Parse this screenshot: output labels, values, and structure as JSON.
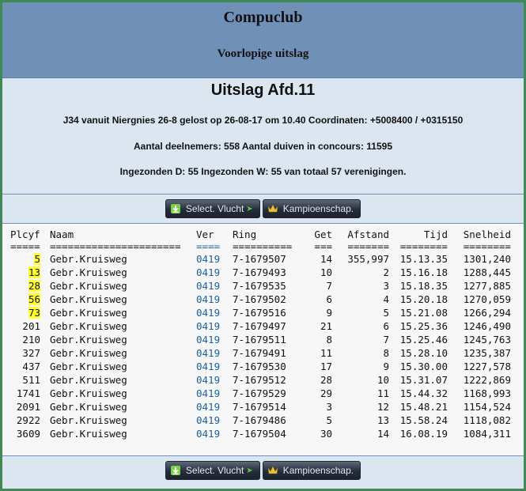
{
  "header": {
    "club": "Compuclub",
    "subtitle": "Voorlopige uitslag"
  },
  "info": {
    "title": "Uitslag Afd.11",
    "line1": "J34 vanuit Niergnies 26-8 gelost op 26-08-17 om 10.40 Coordinaten: +5008400 / +0315150",
    "line2": "Aantal deelnemers: 558 Aantal duiven in concours: 11595",
    "line3": "Ingezonden D: 55 Ingezonden W: 55 van totaal 57 verenigingen."
  },
  "buttons": {
    "select_flight": "Select. Vlucht",
    "championship": "Kampioenschap."
  },
  "colors": {
    "header_bg": "#7090b8",
    "page_bg": "#dce6f0",
    "border": "#3f8a56",
    "highlight": "#ffff33",
    "link": "#1a5fa0"
  },
  "table": {
    "headers": [
      "Plcyf",
      "Naam",
      "Ver",
      "Ring",
      "Get",
      "Afstand",
      "Tijd",
      "Snelheid"
    ],
    "separators": [
      "=====",
      "======================",
      "====",
      "==========",
      "===",
      "=======",
      "========",
      "========"
    ],
    "rows": [
      {
        "plcyf": "5",
        "naam": "Gebr.Kruisweg",
        "ver": "0419",
        "ring": "7-1679507",
        "get": "14",
        "afstand": "355,997",
        "tijd": "15.13.35",
        "snelheid": "1301,240",
        "hl": true
      },
      {
        "plcyf": "13",
        "naam": "Gebr.Kruisweg",
        "ver": "0419",
        "ring": "7-1679493",
        "get": "10",
        "afstand": "2",
        "tijd": "15.16.18",
        "snelheid": "1288,445",
        "hl": true
      },
      {
        "plcyf": "28",
        "naam": "Gebr.Kruisweg",
        "ver": "0419",
        "ring": "7-1679535",
        "get": "7",
        "afstand": "3",
        "tijd": "15.18.35",
        "snelheid": "1277,885",
        "hl": true
      },
      {
        "plcyf": "56",
        "naam": "Gebr.Kruisweg",
        "ver": "0419",
        "ring": "7-1679502",
        "get": "6",
        "afstand": "4",
        "tijd": "15.20.18",
        "snelheid": "1270,059",
        "hl": true
      },
      {
        "plcyf": "73",
        "naam": "Gebr.Kruisweg",
        "ver": "0419",
        "ring": "7-1679516",
        "get": "9",
        "afstand": "5",
        "tijd": "15.21.08",
        "snelheid": "1266,294",
        "hl": true
      },
      {
        "plcyf": "201",
        "naam": "Gebr.Kruisweg",
        "ver": "0419",
        "ring": "7-1679497",
        "get": "21",
        "afstand": "6",
        "tijd": "15.25.36",
        "snelheid": "1246,490",
        "hl": false
      },
      {
        "plcyf": "210",
        "naam": "Gebr.Kruisweg",
        "ver": "0419",
        "ring": "7-1679511",
        "get": "8",
        "afstand": "7",
        "tijd": "15.25.46",
        "snelheid": "1245,763",
        "hl": false
      },
      {
        "plcyf": "327",
        "naam": "Gebr.Kruisweg",
        "ver": "0419",
        "ring": "7-1679491",
        "get": "11",
        "afstand": "8",
        "tijd": "15.28.10",
        "snelheid": "1235,387",
        "hl": false
      },
      {
        "plcyf": "437",
        "naam": "Gebr.Kruisweg",
        "ver": "0419",
        "ring": "7-1679530",
        "get": "17",
        "afstand": "9",
        "tijd": "15.30.00",
        "snelheid": "1227,578",
        "hl": false
      },
      {
        "plcyf": "511",
        "naam": "Gebr.Kruisweg",
        "ver": "0419",
        "ring": "7-1679512",
        "get": "28",
        "afstand": "10",
        "tijd": "15.31.07",
        "snelheid": "1222,869",
        "hl": false
      },
      {
        "plcyf": "1741",
        "naam": "Gebr.Kruisweg",
        "ver": "0419",
        "ring": "7-1679529",
        "get": "29",
        "afstand": "11",
        "tijd": "15.44.32",
        "snelheid": "1168,993",
        "hl": false
      },
      {
        "plcyf": "2091",
        "naam": "Gebr.Kruisweg",
        "ver": "0419",
        "ring": "7-1679514",
        "get": "3",
        "afstand": "12",
        "tijd": "15.48.21",
        "snelheid": "1154,524",
        "hl": false
      },
      {
        "plcyf": "2922",
        "naam": "Gebr.Kruisweg",
        "ver": "0419",
        "ring": "7-1679486",
        "get": "5",
        "afstand": "13",
        "tijd": "15.58.24",
        "snelheid": "1118,082",
        "hl": false
      },
      {
        "plcyf": "3609",
        "naam": "Gebr.Kruisweg",
        "ver": "0419",
        "ring": "7-1679504",
        "get": "30",
        "afstand": "14",
        "tijd": "16.08.19",
        "snelheid": "1084,311",
        "hl": false
      }
    ]
  }
}
